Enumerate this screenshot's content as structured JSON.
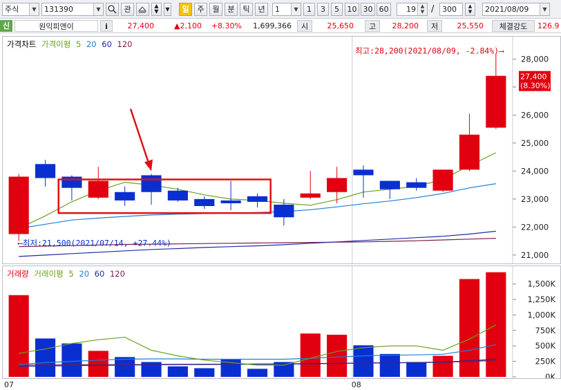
{
  "toolbar": {
    "market": "주식",
    "code": "131390",
    "search_icon": "search-icon",
    "watch_label": "관",
    "period_day": "일",
    "period_week": "주",
    "period_month": "월",
    "period_minute": "분",
    "period_tick": "틱",
    "period_year": "년",
    "multiplier": "1",
    "quick_counts": [
      "1",
      "3",
      "5",
      "10",
      "30",
      "60"
    ],
    "visible_count": "19",
    "separator": "/",
    "total_count": "300",
    "date": "2021/08/09"
  },
  "quote": {
    "credit_badge": "신",
    "name": "원익피앤이",
    "info_button": "i",
    "price": "27,400",
    "change": "▲2,100",
    "change_rate": "+8.30%",
    "volume": "1,699,366",
    "open_label": "시",
    "open": "25,650",
    "high_label": "고",
    "high": "28,200",
    "low_label": "저",
    "low": "25,550",
    "strength_label": "체결강도",
    "strength": "126.9"
  },
  "colors": {
    "up": "#e1000f",
    "down": "#0a2fd1",
    "ma5": "#6aa01c",
    "ma20": "#1f7fd6",
    "ma60": "#1f2aa6",
    "ma120": "#7a1c4a",
    "highlight_box": "#e01010",
    "arrow": "#e01010"
  },
  "chart_data": [
    {
      "type": "candlestick",
      "legend": [
        {
          "label": "가격차트",
          "color": "#000000"
        },
        {
          "label": "가격이평",
          "color": "#6aa01c"
        },
        {
          "label": "5",
          "color": "#6aa01c"
        },
        {
          "label": "20",
          "color": "#1f7fd6"
        },
        {
          "label": "60",
          "color": "#1f2aa6"
        },
        {
          "label": "120",
          "color": "#7a1c4a"
        }
      ],
      "ylim": [
        20700,
        28800
      ],
      "yticks": [
        21000,
        22000,
        23000,
        24000,
        25000,
        26000,
        27000,
        28000
      ],
      "ytick_labels": [
        "21,000",
        "22,000",
        "23,000",
        "24,000",
        "25,000",
        "26,000",
        "27,000",
        "28,000"
      ],
      "x_labels": [
        {
          "index": 0,
          "label": "07"
        },
        {
          "index": 13,
          "label": "08"
        }
      ],
      "candles": [
        {
          "open": 21750,
          "high": 23900,
          "low": 21500,
          "close": 23800
        },
        {
          "open": 24250,
          "high": 24400,
          "low": 23450,
          "close": 23750
        },
        {
          "open": 23800,
          "high": 23850,
          "low": 22950,
          "close": 23400
        },
        {
          "open": 23050,
          "high": 24150,
          "low": 23000,
          "close": 23650
        },
        {
          "open": 23250,
          "high": 23450,
          "low": 22750,
          "close": 22950
        },
        {
          "open": 23850,
          "high": 23900,
          "low": 22800,
          "close": 23250
        },
        {
          "open": 23300,
          "high": 23400,
          "low": 22900,
          "close": 22950
        },
        {
          "open": 23000,
          "high": 23100,
          "low": 22650,
          "close": 22750
        },
        {
          "open": 22950,
          "high": 23650,
          "low": 22600,
          "close": 22850
        },
        {
          "open": 23100,
          "high": 23200,
          "low": 22700,
          "close": 22900
        },
        {
          "open": 22800,
          "high": 23000,
          "low": 22050,
          "close": 22350
        },
        {
          "open": 23050,
          "high": 24000,
          "low": 23000,
          "close": 23200
        },
        {
          "open": 23250,
          "high": 24150,
          "low": 22850,
          "close": 23750
        },
        {
          "open": 24050,
          "high": 24200,
          "low": 23050,
          "close": 23850
        },
        {
          "open": 23650,
          "high": 23650,
          "low": 23000,
          "close": 23350
        },
        {
          "open": 23600,
          "high": 23750,
          "low": 23300,
          "close": 23400
        },
        {
          "open": 23300,
          "high": 24050,
          "low": 23250,
          "close": 24050
        },
        {
          "open": 24050,
          "high": 26050,
          "low": 24000,
          "close": 25300
        },
        {
          "open": 25550,
          "high": 28200,
          "low": 25500,
          "close": 27400
        }
      ],
      "ma5": [
        21950,
        22400,
        22900,
        23300,
        23600,
        23500,
        23350,
        23150,
        23000,
        22950,
        22850,
        22780,
        22980,
        23250,
        23350,
        23450,
        23700,
        24200,
        24650
      ],
      "ma20": [
        21950,
        22100,
        22250,
        22320,
        22380,
        22430,
        22460,
        22480,
        22500,
        22520,
        22550,
        22620,
        22720,
        22830,
        22930,
        23050,
        23200,
        23400,
        23550
      ],
      "ma60": [
        20950,
        21000,
        21050,
        21100,
        21150,
        21200,
        21230,
        21270,
        21300,
        21330,
        21370,
        21420,
        21470,
        21520,
        21570,
        21620,
        21670,
        21750,
        21850
      ],
      "ma120": [
        21300,
        21320,
        21340,
        21360,
        21380,
        21390,
        21400,
        21410,
        21420,
        21430,
        21440,
        21450,
        21460,
        21470,
        21490,
        21510,
        21540,
        21570,
        21600
      ],
      "annotations": {
        "high": "최고:28,200(2021/08/09, -2.84%)⟶",
        "low": "⟵최저:21,500(2021/07/14, +27.44%)",
        "last_price": "27,400",
        "last_rate": "(8.30%)"
      },
      "highlight_range": [
        2,
        9
      ],
      "highlight_price_range": [
        22500,
        23700
      ],
      "arrow_target_index": 5
    },
    {
      "type": "bar",
      "legend": [
        {
          "label": "거래량",
          "color": "#e1000f"
        },
        {
          "label": "거래이평",
          "color": "#6aa01c"
        },
        {
          "label": "5",
          "color": "#6aa01c"
        },
        {
          "label": "20",
          "color": "#1f7fd6"
        },
        {
          "label": "60",
          "color": "#1f2aa6"
        },
        {
          "label": "120",
          "color": "#7a1c4a"
        }
      ],
      "ylim": [
        0,
        1720000
      ],
      "yticks": [
        0,
        250000,
        500000,
        750000,
        1000000,
        1250000,
        1500000
      ],
      "ytick_labels": [
        "0K",
        "250K",
        "500K",
        "750K",
        "1,000K",
        "1,250K",
        "1,500K"
      ],
      "values": [
        1320000,
        620000,
        540000,
        420000,
        320000,
        240000,
        170000,
        140000,
        280000,
        130000,
        240000,
        700000,
        680000,
        510000,
        370000,
        240000,
        340000,
        1580000,
        1690000
      ],
      "ma5": [
        380000,
        450000,
        540000,
        600000,
        640000,
        430000,
        340000,
        270000,
        230000,
        190000,
        190000,
        300000,
        410000,
        470000,
        500000,
        500000,
        430000,
        610000,
        840000
      ],
      "ma20": [
        200000,
        230000,
        250000,
        270000,
        285000,
        290000,
        290000,
        285000,
        285000,
        285000,
        285000,
        300000,
        320000,
        340000,
        350000,
        355000,
        365000,
        430000,
        520000
      ],
      "ma60": [
        170000,
        175000,
        180000,
        185000,
        190000,
        195000,
        198000,
        200000,
        202000,
        204000,
        206000,
        212000,
        218000,
        224000,
        228000,
        232000,
        238000,
        260000,
        285000
      ],
      "ma120": [
        190000,
        192000,
        194000,
        196000,
        198000,
        200000,
        202000,
        204000,
        206000,
        208000,
        210000,
        214000,
        218000,
        222000,
        226000,
        230000,
        236000,
        250000,
        265000
      ]
    }
  ]
}
